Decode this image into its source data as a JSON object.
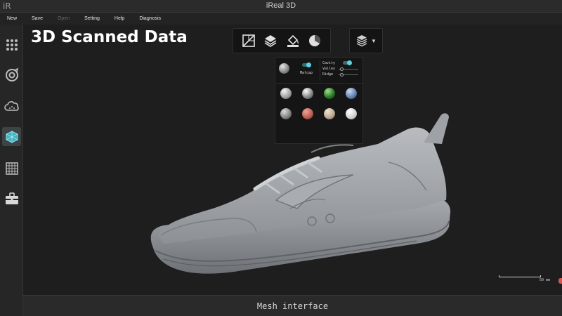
{
  "window": {
    "logo": "iR",
    "title": "iReal 3D"
  },
  "menu": [
    {
      "label": "New",
      "enabled": true
    },
    {
      "label": "Save",
      "enabled": true
    },
    {
      "label": "Open",
      "enabled": false
    },
    {
      "label": "Setting",
      "enabled": true
    },
    {
      "label": "Help",
      "enabled": true
    },
    {
      "label": "Diagnosis",
      "enabled": true
    }
  ],
  "sidebar": {
    "items": [
      {
        "name": "grid-dots-icon",
        "active": false
      },
      {
        "name": "turntable-scan-icon",
        "active": false
      },
      {
        "name": "cloud-icon",
        "active": false
      },
      {
        "name": "mesh-cube-icon",
        "active": true
      },
      {
        "name": "texture-grid-icon",
        "active": false
      },
      {
        "name": "toolbox-icon",
        "active": false
      }
    ]
  },
  "viewport": {
    "caption": "3D Scanned Data",
    "toolbar": [
      "section-plane-icon",
      "layers-icon",
      "paint-bucket-icon",
      "shading-sphere-icon"
    ],
    "display_mode_icon": "stacked-cube-icon",
    "matcap_panel": {
      "matcap_label": "Matcap",
      "matcap_enabled": true,
      "cavity_label": "Cavity",
      "cavity_enabled": true,
      "valley_label": "Valley",
      "ridge_label": "Ridge",
      "materials": [
        "#c9c9c9",
        "#bdbdbd",
        "#2f7a2a",
        "#7b9bc7",
        "#a5a5a5",
        "#b85b50",
        "#c8b6a0",
        "#e4e4e4"
      ]
    },
    "scale_label": "50 mm"
  },
  "status": {
    "text": "Mesh interface"
  },
  "colors": {
    "accent": "#5ad2e0",
    "background": "#1e1e1e",
    "model": "#9a9ea2"
  }
}
